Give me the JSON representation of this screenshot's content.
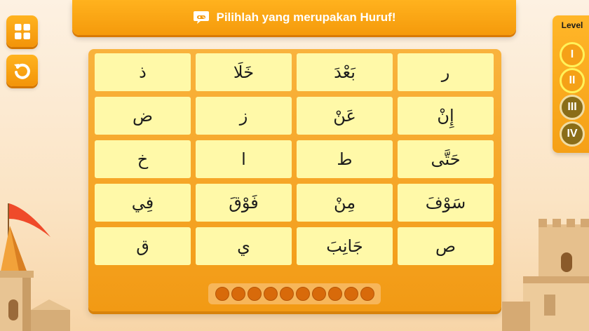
{
  "banner": {
    "icon": "chat-gamepad-icon",
    "text": "Pilihlah yang merupakan Huruf!"
  },
  "side_buttons": [
    {
      "name": "menu",
      "icon": "grid-icon"
    },
    {
      "name": "restart",
      "icon": "restart-icon"
    }
  ],
  "level": {
    "title": "Level",
    "items": [
      {
        "label": "I",
        "state": "active"
      },
      {
        "label": "II",
        "state": "active"
      },
      {
        "label": "III",
        "state": "locked"
      },
      {
        "label": "IV",
        "state": "locked"
      }
    ]
  },
  "board": {
    "cells": [
      [
        "ذ",
        "خَلَا",
        "بَعْدَ",
        "ر"
      ],
      [
        "ض",
        "ز",
        "عَنْ",
        "إِنْ"
      ],
      [
        "خ",
        "ا",
        "ط",
        "حَتَّى"
      ],
      [
        "فِي",
        "فَوْقَ",
        "مِنْ",
        "سَوْفَ"
      ],
      [
        "ق",
        "ي",
        "جَانِبَ",
        "ص"
      ]
    ]
  },
  "progress": {
    "total": 10,
    "filled": 0
  },
  "colors": {
    "accent": "#f5a016",
    "cell": "#fff9a8",
    "dot": "#d86a0a",
    "level_active_ring": "#fff25a",
    "level_locked": "#8a6d18"
  }
}
